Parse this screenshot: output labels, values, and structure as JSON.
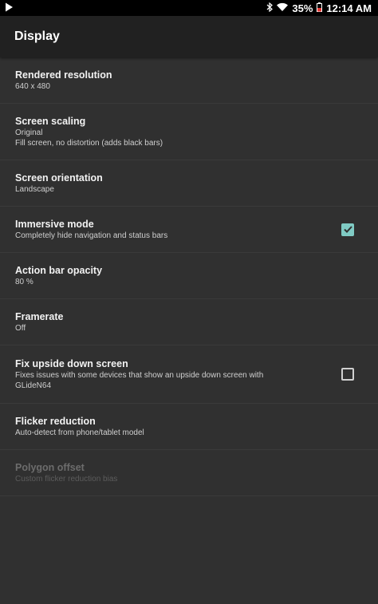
{
  "status_bar": {
    "battery_percent": "35%",
    "time": "12:14 AM"
  },
  "app_bar": {
    "title": "Display"
  },
  "preferences": [
    {
      "title": "Rendered resolution",
      "summary": "640 x 480"
    },
    {
      "title": "Screen scaling",
      "summary": "Original",
      "summary2": "Fill screen, no distortion (adds black bars)"
    },
    {
      "title": "Screen orientation",
      "summary": "Landscape"
    },
    {
      "title": "Immersive mode",
      "summary": "Completely hide navigation and status bars",
      "checked": true
    },
    {
      "title": "Action bar opacity",
      "summary": "80 %"
    },
    {
      "title": "Framerate",
      "summary": "Off"
    },
    {
      "title": "Fix upside down screen",
      "summary": "Fixes issues with some devices that show an upside down screen with",
      "summary2": "GLideN64",
      "checked": false
    },
    {
      "title": "Flicker reduction",
      "summary": "Auto-detect from phone/tablet model"
    },
    {
      "title": "Polygon offset",
      "summary": "Custom flicker reduction bias",
      "disabled": true
    }
  ],
  "icons": {
    "app_notification": "play-store-icon",
    "bluetooth": "bluetooth-icon",
    "wifi": "wifi-icon",
    "battery": "battery-icon"
  },
  "colors": {
    "background": "#303030",
    "app_bar": "#212121",
    "accent": "#80cbc4"
  }
}
